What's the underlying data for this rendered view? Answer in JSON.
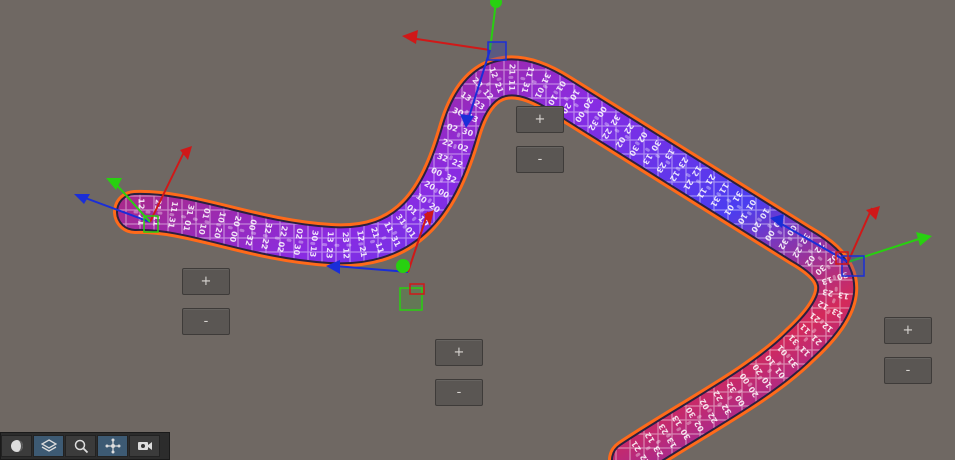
{
  "spline": {
    "outline_color": "#ff6a1a",
    "tube_colors": [
      "#c02848",
      "#8a2be2",
      "#4b3df0",
      "#d42a5a"
    ],
    "tile_labels": [
      "12",
      "21",
      "11",
      "31",
      "01",
      "10",
      "20",
      "00",
      "32",
      "22",
      "02",
      "30",
      "13",
      "23"
    ]
  },
  "gizmo_colors": {
    "x": "#d01818",
    "y": "#28d010",
    "z": "#1a2ed8"
  },
  "buttons": {
    "plus": "+",
    "minus": "-"
  },
  "toolbar": {
    "tools": [
      {
        "icon": "sphere-shading-icon",
        "active": false
      },
      {
        "icon": "layers-icon",
        "active": true
      },
      {
        "icon": "search-icon",
        "active": false
      },
      {
        "icon": "move-nodes-icon",
        "active": true
      },
      {
        "icon": "camera-view-icon",
        "active": false
      }
    ]
  }
}
